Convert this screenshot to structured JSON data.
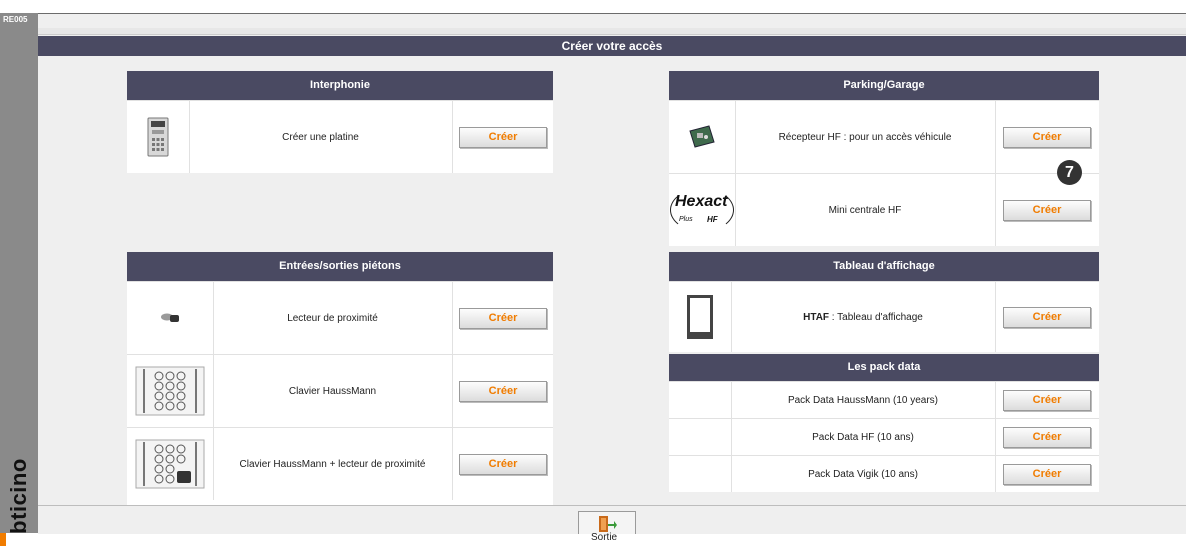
{
  "app": {
    "code": "RE005",
    "brand": "bticino",
    "title": "Créer votre accès"
  },
  "create_label": "Créer",
  "step_badge": "7",
  "exit_label": "Sortie",
  "panels": {
    "interphonie": {
      "title": "Interphonie",
      "rows": [
        {
          "label": "Créer une platine",
          "icon": "door-entry-panel-icon"
        }
      ]
    },
    "pietons": {
      "title": "Entrées/sorties piétons",
      "rows": [
        {
          "label": "Lecteur de proximité",
          "icon": "proximity-badge-icon"
        },
        {
          "label": "Clavier HaussMann",
          "icon": "keypad-icon"
        },
        {
          "label": "Clavier HaussMann + lecteur de proximité",
          "icon": "keypad-badge-icon"
        }
      ]
    },
    "parking": {
      "title": "Parking/Garage",
      "rows": [
        {
          "label": "Récepteur HF : pour un accès véhicule",
          "icon": "hf-receiver-board-icon"
        },
        {
          "label": "Mini centrale HF",
          "icon": "hexact-logo"
        }
      ]
    },
    "affichage": {
      "title": "Tableau d'affichage",
      "rows": [
        {
          "label_bold": "HTAF",
          "label_rest": " : Tableau d'affichage",
          "icon": "display-board-icon"
        }
      ]
    },
    "pack": {
      "title": "Les pack data",
      "rows": [
        {
          "label": "Pack Data HaussMann (10 years)"
        },
        {
          "label": "Pack Data HF (10 ans)"
        },
        {
          "label": "Pack Data Vigik (10 ans)"
        }
      ]
    }
  },
  "logos": {
    "hexact_top": "Hexact",
    "hexact_bottom_left": "Plus",
    "hexact_bottom_right": "HF"
  }
}
